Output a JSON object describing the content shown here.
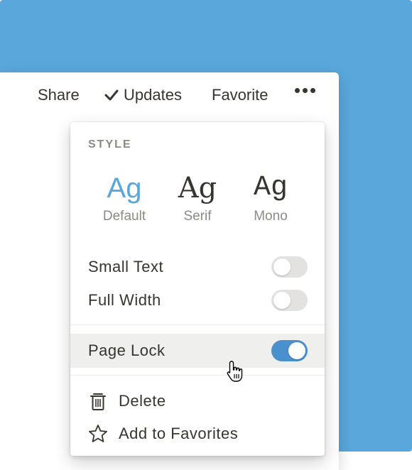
{
  "topbar": {
    "share": "Share",
    "updates": "Updates",
    "favorite": "Favorite"
  },
  "menu": {
    "section_label": "STYLE",
    "fonts": [
      {
        "glyph": "Ag",
        "caption": "Default",
        "selected": true
      },
      {
        "glyph": "Ag",
        "caption": "Serif",
        "selected": false
      },
      {
        "glyph": "Ag",
        "caption": "Mono",
        "selected": false
      }
    ],
    "toggles": [
      {
        "label": "Small Text",
        "on": false
      },
      {
        "label": "Full Width",
        "on": false
      },
      {
        "label": "Page Lock",
        "on": true
      }
    ],
    "actions": [
      {
        "label": "Delete",
        "icon": "trash-icon"
      },
      {
        "label": "Add to Favorites",
        "icon": "star-icon"
      }
    ]
  },
  "colors": {
    "backdrop": "#5aa7db",
    "accent": "#4a90cf",
    "text": "#37352f",
    "muted": "#8c8a85"
  }
}
